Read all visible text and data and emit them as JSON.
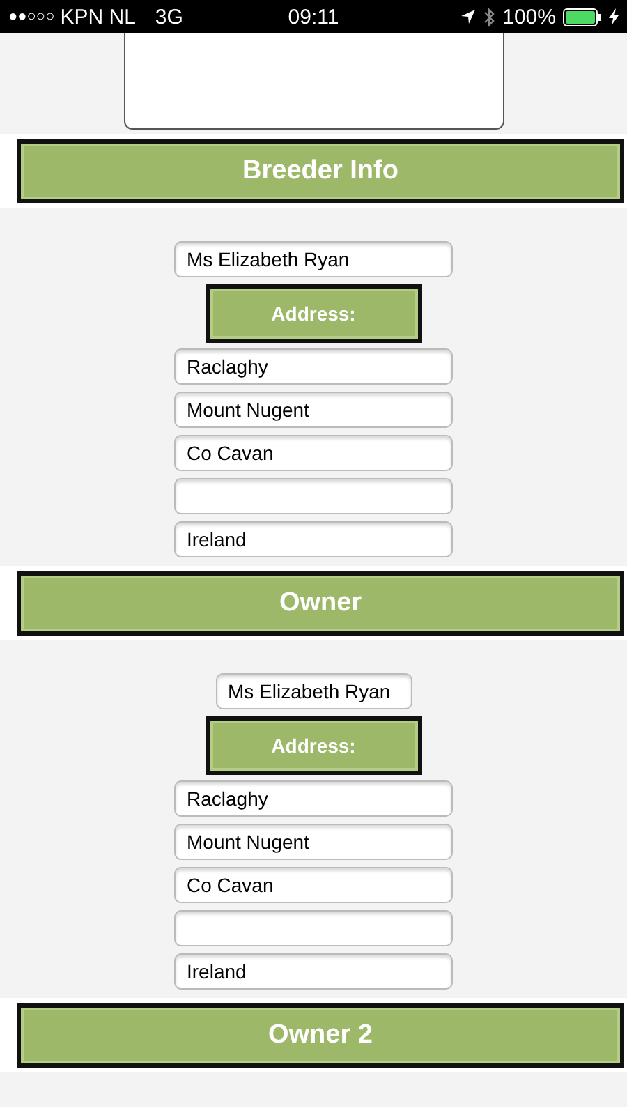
{
  "status_bar": {
    "signal_bars": "●●○○○",
    "carrier": "KPN NL",
    "network": "3G",
    "time": "09:11",
    "battery": "100%"
  },
  "sections": [
    {
      "title": "Breeder Info",
      "name_field": {
        "value": "Ms Elizabeth Ryan",
        "kind": "full"
      },
      "address_button": "Address:",
      "address_lines": [
        {
          "kind": "filled",
          "value": "Raclaghy"
        },
        {
          "kind": "filled",
          "value": "Mount Nugent"
        },
        {
          "kind": "filled",
          "value": "Co Cavan"
        },
        {
          "kind": "empty"
        },
        {
          "kind": "filled",
          "value": "Ireland"
        }
      ]
    },
    {
      "title": "Owner",
      "name_field": {
        "value": "Ms Elizabeth Ryan",
        "kind": "fit"
      },
      "address_button": "Address:",
      "address_lines": [
        {
          "kind": "filled",
          "value": "Raclaghy"
        },
        {
          "kind": "filled",
          "value": "Mount Nugent"
        },
        {
          "kind": "filled",
          "value": "Co Cavan"
        },
        {
          "kind": "empty"
        },
        {
          "kind": "filled",
          "value": "Ireland"
        }
      ]
    },
    {
      "title": "Owner 2"
    }
  ]
}
